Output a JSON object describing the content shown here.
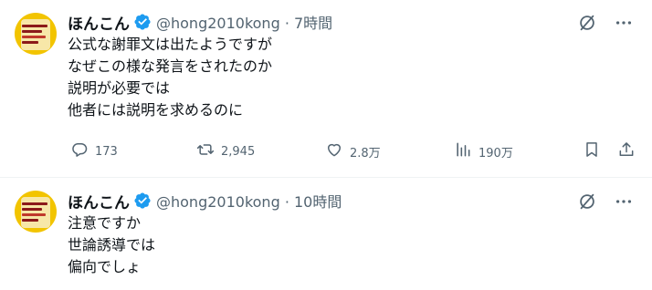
{
  "tweets": [
    {
      "author": {
        "name": "ほんこん",
        "handle": "@hong2010kong",
        "time": "7時間"
      },
      "handle_time": "@hong2010kong · 7時間",
      "lines": [
        "公式な謝罪文は出たようですが",
        "なぜこの様な発言をされたのか",
        "説明が必要では",
        "他者には説明を求めるのに"
      ],
      "stats": {
        "replies": "173",
        "retweets": "2,945",
        "likes": "2.8万",
        "views": "190万"
      }
    },
    {
      "author": {
        "name": "ほんこん",
        "handle": "@hong2010kong",
        "time": "10時間"
      },
      "handle_time": "@hong2010kong · 10時間",
      "lines": [
        "注意ですか",
        "世論誘導では",
        "偏向でしょ"
      ]
    }
  ],
  "icons": {
    "verified": "verified-badge-icon",
    "grok": "grok-icon",
    "more": "more-dots-icon",
    "reply": "reply-icon",
    "retweet": "retweet-icon",
    "like": "heart-icon",
    "views": "views-icon",
    "bookmark": "bookmark-icon",
    "share": "share-icon"
  },
  "colors": {
    "verified": "#1d9bf0",
    "secondary_text": "#536471",
    "text": "#0f1419",
    "divider": "#eff3f4"
  }
}
